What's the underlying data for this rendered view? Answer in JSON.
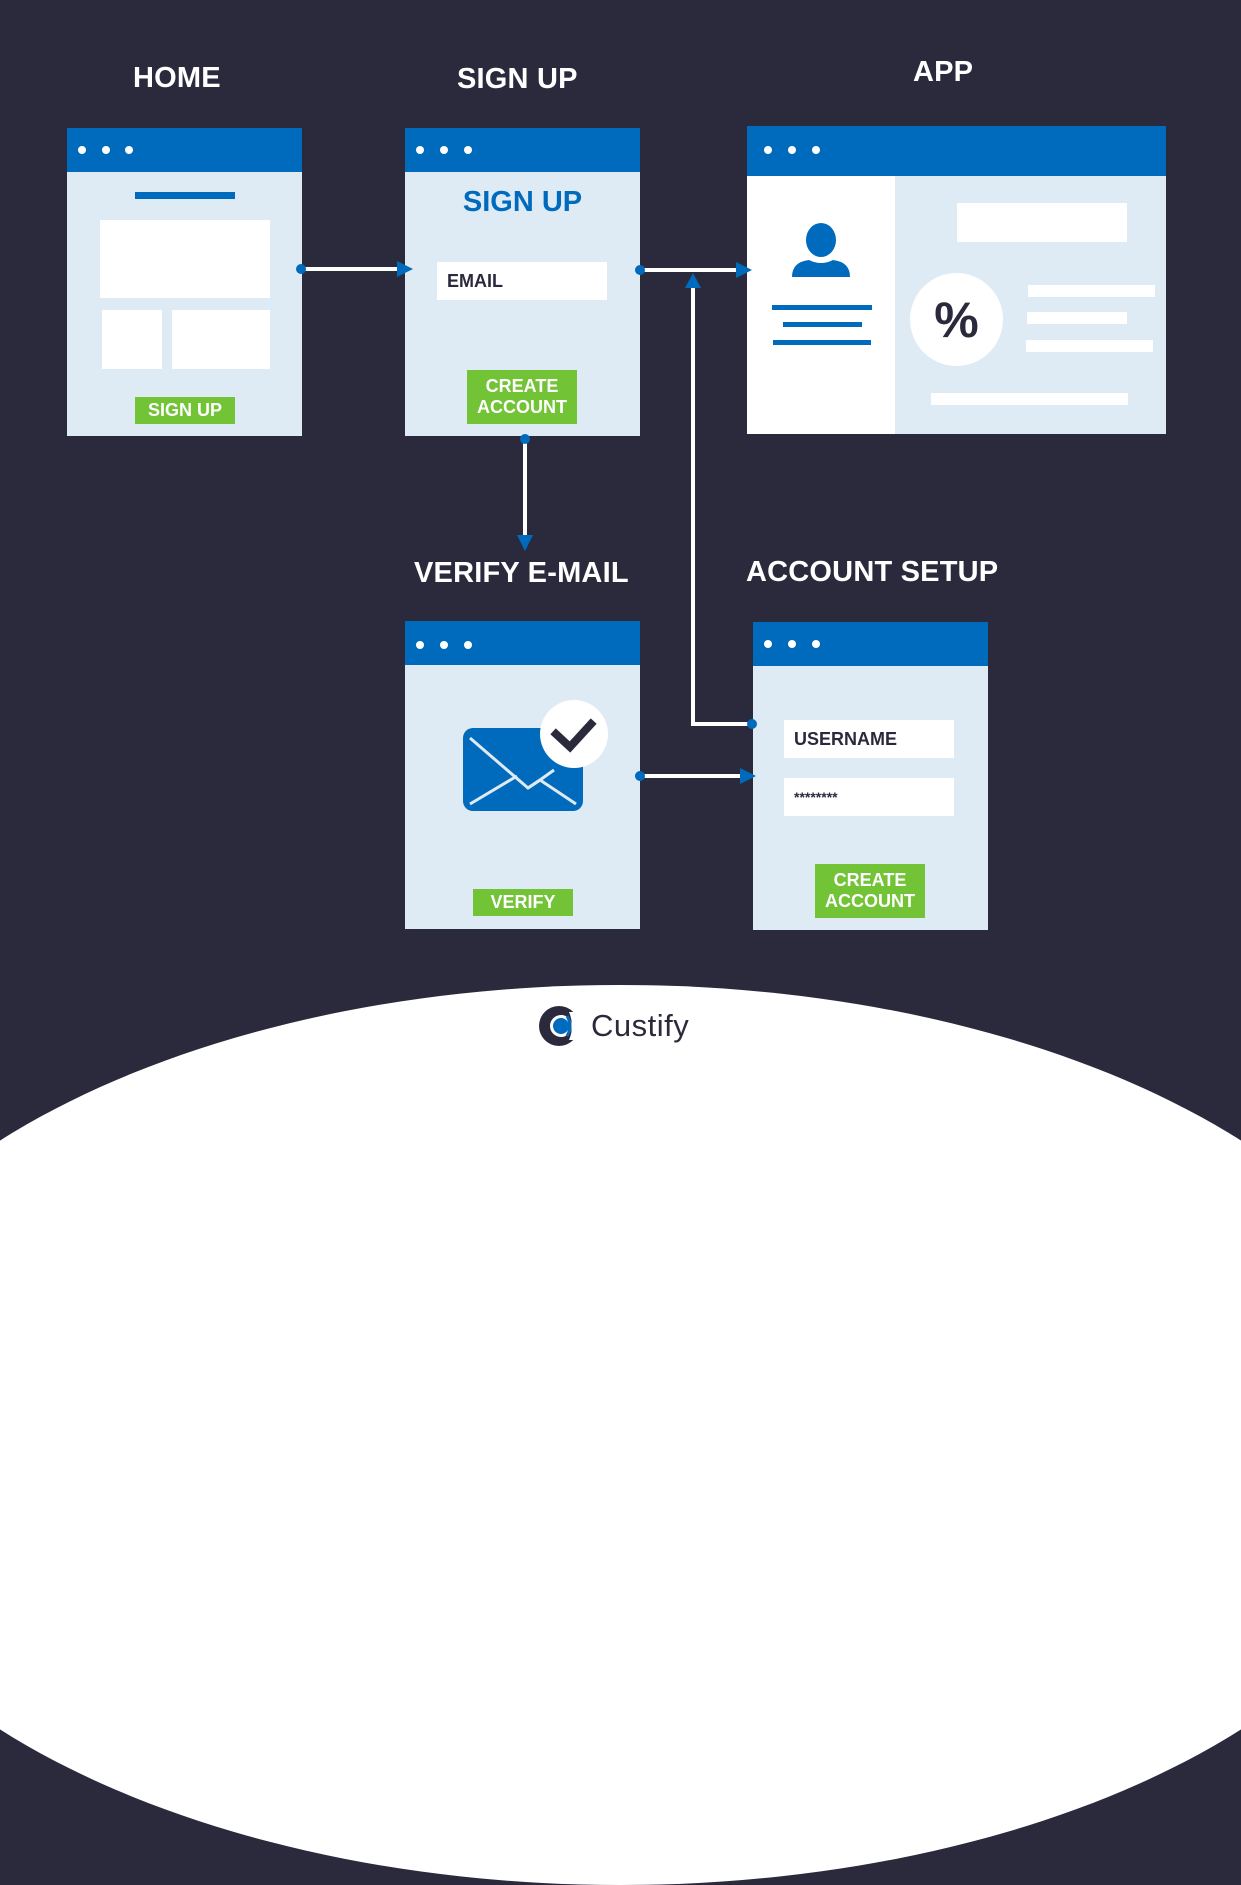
{
  "colors": {
    "background": "#2b2a3d",
    "window_bar": "#006bbd",
    "window_body": "#deeaf4",
    "button_green": "#72c335",
    "text_dark": "#2b2a3d",
    "connector": "#ffffff",
    "connector_marker": "#006bbd"
  },
  "screens": {
    "home": {
      "title": "HOME",
      "button_label": "SIGN UP"
    },
    "signup": {
      "title": "SIGN UP",
      "heading": "SIGN UP",
      "email_field": "EMAIL",
      "button_label_line1": "CREATE",
      "button_label_line2": "ACCOUNT"
    },
    "app": {
      "title": "APP",
      "percent_icon_label": "%"
    },
    "verify": {
      "title": "VERIFY E-MAIL",
      "button_label": "VERIFY"
    },
    "account_setup": {
      "title": "ACCOUNT SETUP",
      "username_field": "USERNAME",
      "password_field": "********",
      "button_label_line1": "CREATE",
      "button_label_line2": "ACCOUNT"
    }
  },
  "flow": [
    {
      "from": "HOME",
      "to": "SIGN UP"
    },
    {
      "from": "SIGN UP",
      "to": "APP"
    },
    {
      "from": "SIGN UP",
      "to": "VERIFY E-MAIL"
    },
    {
      "from": "VERIFY E-MAIL",
      "to": "ACCOUNT SETUP"
    },
    {
      "from": "ACCOUNT SETUP",
      "to": "APP"
    }
  ],
  "brand": {
    "name": "Custify"
  }
}
